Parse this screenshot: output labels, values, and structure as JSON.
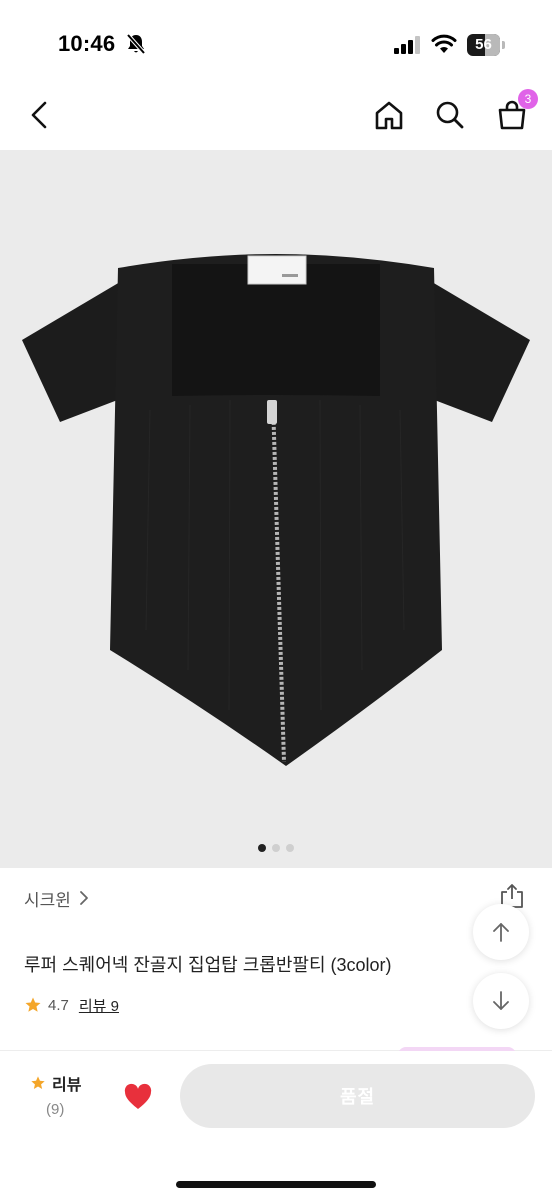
{
  "status_bar": {
    "time": "10:46",
    "battery_percent": "56",
    "battery_level": 0.56
  },
  "nav": {
    "cart_badge": "3",
    "icons": [
      "chevron-left-icon",
      "home-icon",
      "search-icon",
      "shopping-bag-icon"
    ]
  },
  "gallery": {
    "image": "black-square-neck-zip-crop-top",
    "page_count": 3,
    "current_page": 1
  },
  "product": {
    "brand": "시크윈",
    "brand_chevron": ">",
    "title": "루퍼 스퀘어넥 잔골지 집업탑 크롭반팔티 (3color)",
    "rating": "4.7",
    "review_link": "리뷰 9"
  },
  "bottom_bar": {
    "review_label": "리뷰",
    "review_count": "(9)",
    "cta_label": "품절"
  },
  "colors": {
    "badge": "#e063e8",
    "star": "#f4a62a",
    "heart": "#e8303c",
    "cta_disabled": "#e8e8e8",
    "gallery_bg": "#ebebeb"
  }
}
